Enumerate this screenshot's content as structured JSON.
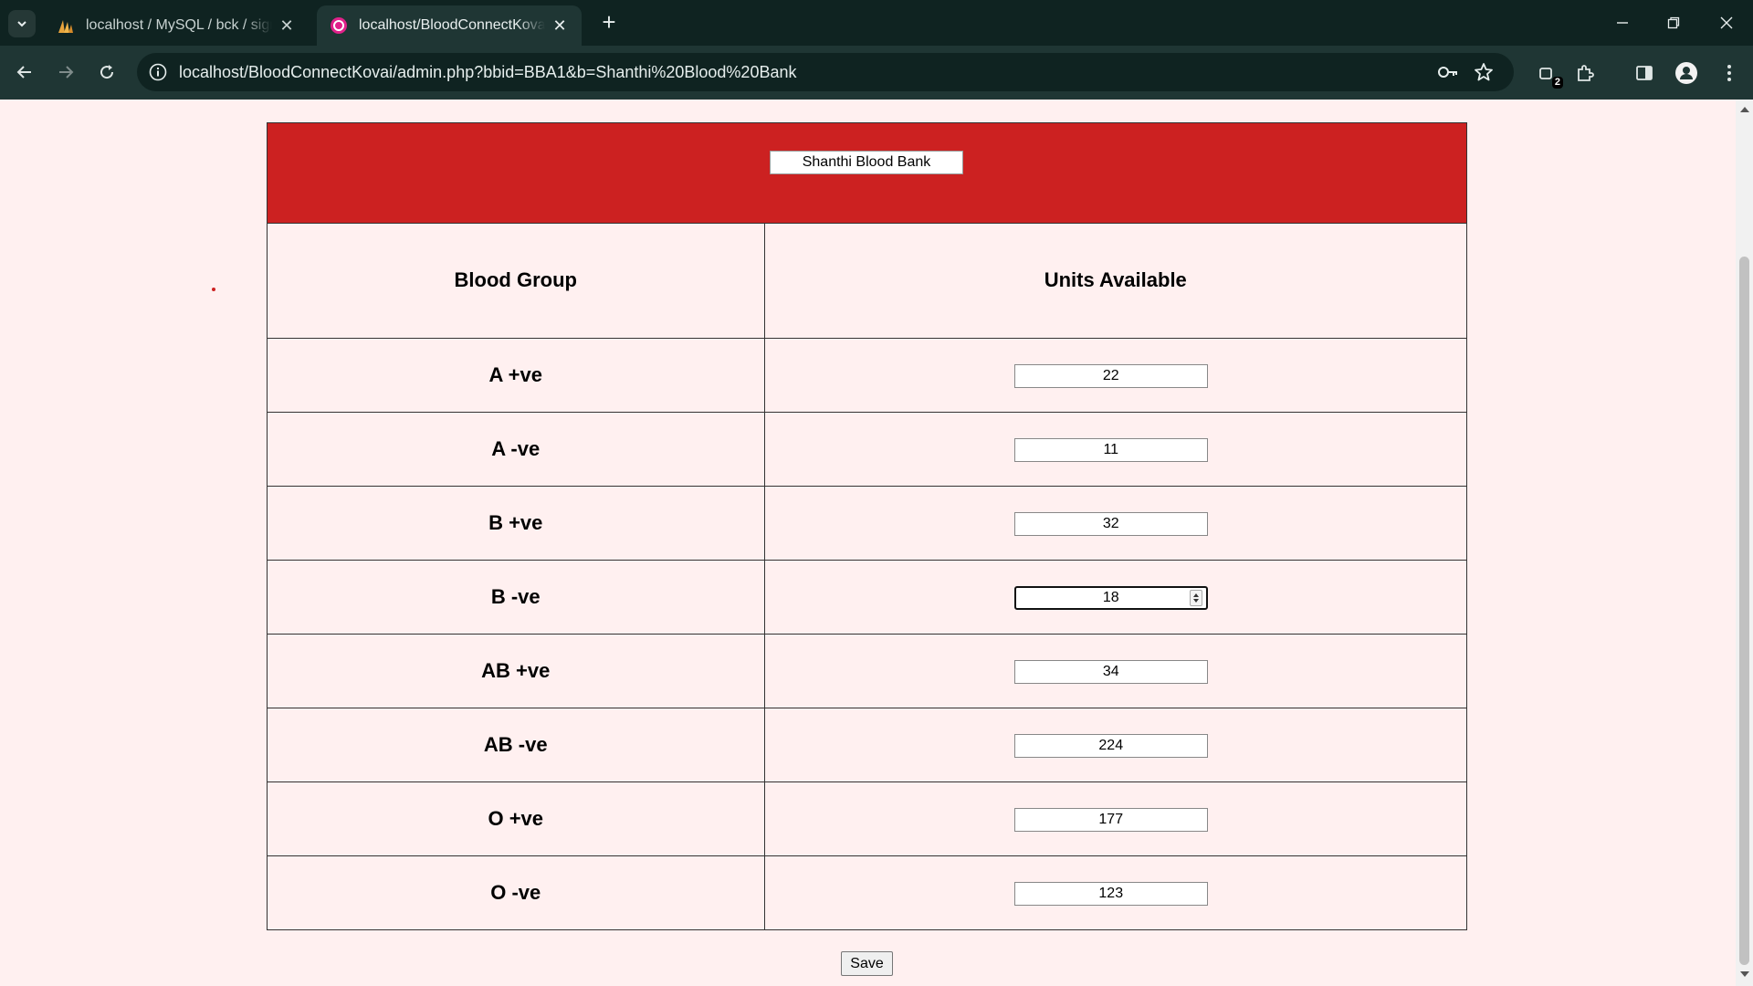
{
  "browser": {
    "tabs": [
      {
        "title": "localhost / MySQL / bck / signu",
        "icon": "phpmyadmin-icon",
        "active": false
      },
      {
        "title": "localhost/BloodConnectKovai/a",
        "icon": "site-favicon-icon",
        "active": true
      }
    ],
    "url": "localhost/BloodConnectKovai/admin.php?bbid=BBA1&b=Shanthi%20Blood%20Bank",
    "extension_badge": "2"
  },
  "page": {
    "bank_name": "Shanthi Blood Bank",
    "headers": {
      "blood_group": "Blood Group",
      "units_available": "Units Available"
    },
    "rows": [
      {
        "group": "A +ve",
        "units": "22"
      },
      {
        "group": "A -ve",
        "units": "11"
      },
      {
        "group": "B +ve",
        "units": "32"
      },
      {
        "group": "B -ve",
        "units": "18"
      },
      {
        "group": "AB +ve",
        "units": "34"
      },
      {
        "group": "AB -ve",
        "units": "224"
      },
      {
        "group": "O +ve",
        "units": "177"
      },
      {
        "group": "O -ve",
        "units": "123"
      }
    ],
    "save_label": "Save"
  },
  "colors": {
    "header_red": "#cc2121",
    "page_bg": "#fff0f0",
    "chrome_dark": "#0f2321",
    "chrome_toolbar": "#1f3634"
  }
}
